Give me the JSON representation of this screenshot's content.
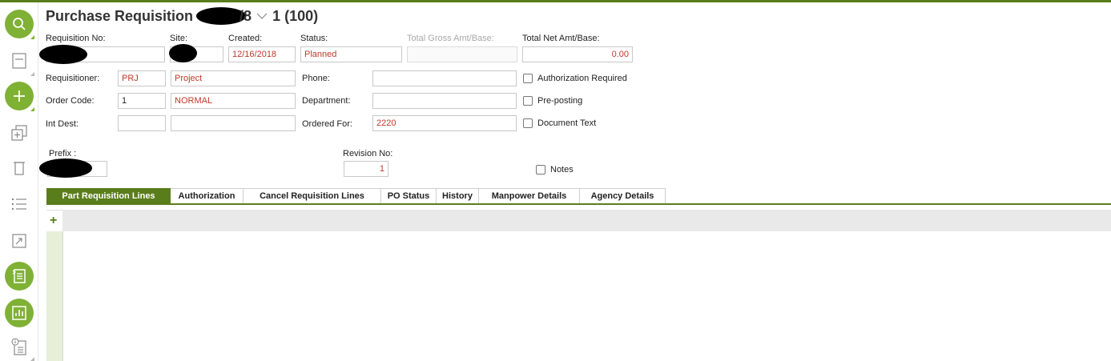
{
  "header": {
    "title_prefix": "Purchase Requisition",
    "title_suffix": "/8",
    "title_count": "1 (100)"
  },
  "form": {
    "requisition_no": {
      "label": "Requisition No:",
      "value": ""
    },
    "site": {
      "label": "Site:",
      "value": ""
    },
    "created": {
      "label": "Created:",
      "value": "12/16/2018"
    },
    "status": {
      "label": "Status:",
      "value": "Planned"
    },
    "total_gross": {
      "label": "Total Gross Amt/Base:",
      "value": ""
    },
    "total_net": {
      "label": "Total Net Amt/Base:",
      "value": "0.00"
    },
    "requisitioner": {
      "label": "Requisitioner:",
      "code": "PRJ",
      "name": "Project"
    },
    "phone": {
      "label": "Phone:",
      "value": ""
    },
    "order_code": {
      "label": "Order Code:",
      "code": "1",
      "name": "NORMAL"
    },
    "department": {
      "label": "Department:",
      "value": ""
    },
    "int_dest": {
      "label": "Int Dest:",
      "code": "",
      "name": ""
    },
    "ordered_for": {
      "label": "Ordered For:",
      "value": "2220"
    },
    "prefix": {
      "label": "Prefix :",
      "value": ""
    },
    "revision_no": {
      "label": "Revision No:",
      "value": "1"
    },
    "checkboxes": {
      "authorization_required": "Authorization Required",
      "pre_posting": "Pre-posting",
      "document_text": "Document Text",
      "notes": "Notes"
    }
  },
  "tabs": [
    {
      "label": "Part Requisition Lines",
      "active": true
    },
    {
      "label": "Authorization",
      "active": false
    },
    {
      "label": "Cancel Requisition Lines",
      "active": false
    },
    {
      "label": "PO Status",
      "active": false
    },
    {
      "label": "History",
      "active": false
    },
    {
      "label": "Manpower Details",
      "active": false
    },
    {
      "label": "Agency Details",
      "active": false
    }
  ],
  "grid": {
    "add_glyph": "+"
  },
  "sidebar_icons": [
    "search-icon",
    "form-icon",
    "add-icon",
    "duplicate-icon",
    "delete-icon",
    "list-icon",
    "navigate-icon",
    "details-list-icon",
    "report-icon",
    "info-document-icon"
  ],
  "colors": {
    "accent": "#7fb135",
    "brand_dark": "#5a7d1c",
    "value_text": "#c0392b"
  }
}
